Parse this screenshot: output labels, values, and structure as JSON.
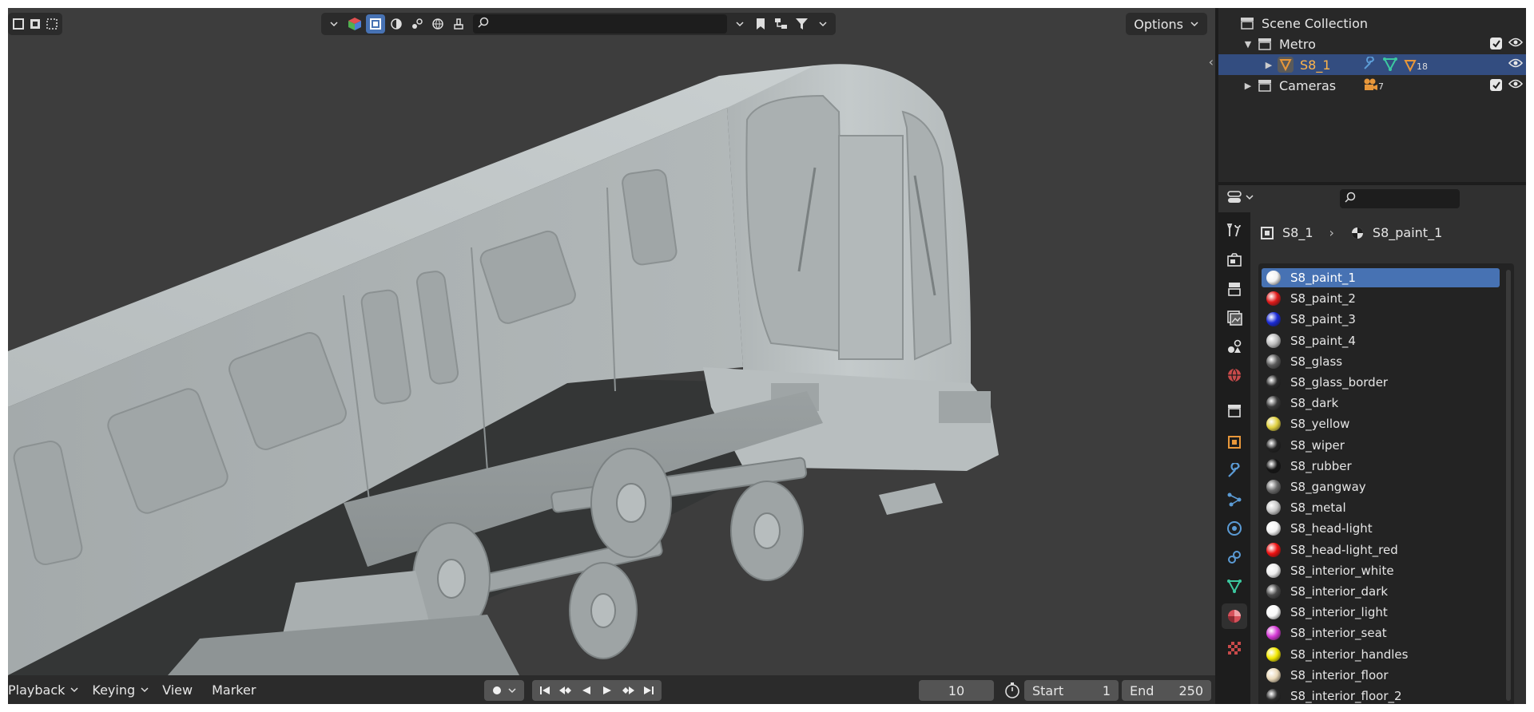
{
  "viewport": {
    "search_placeholder": "",
    "options_label": "Options"
  },
  "outliner": {
    "rows": [
      {
        "label": "Scene Collection"
      },
      {
        "label": "Metro"
      },
      {
        "label": "S8_1",
        "modifier_count": "18"
      },
      {
        "label": "Cameras",
        "camera_count": "7"
      }
    ]
  },
  "properties": {
    "search_placeholder": "",
    "breadcrumb": {
      "object": "S8_1",
      "material": "S8_paint_1"
    },
    "materials": [
      {
        "name": "S8_paint_1",
        "color": "#f2f2f2",
        "selected": true
      },
      {
        "name": "S8_paint_2",
        "color": "#e01a1a"
      },
      {
        "name": "S8_paint_3",
        "color": "#1a2ad6"
      },
      {
        "name": "S8_paint_4",
        "color": "#bdbdbd"
      },
      {
        "name": "S8_glass",
        "color": "#5a5a5a"
      },
      {
        "name": "S8_glass_border",
        "color": "#2a2a2a"
      },
      {
        "name": "S8_dark",
        "color": "#3a3a3a"
      },
      {
        "name": "S8_yellow",
        "color": "#e0d040"
      },
      {
        "name": "S8_wiper",
        "color": "#222222"
      },
      {
        "name": "S8_rubber",
        "color": "#151515"
      },
      {
        "name": "S8_gangway",
        "color": "#6a6a6a"
      },
      {
        "name": "S8_metal",
        "color": "#c8c8c8"
      },
      {
        "name": "S8_head-light",
        "color": "#f4f4f4"
      },
      {
        "name": "S8_head-light_red",
        "color": "#ee1111"
      },
      {
        "name": "S8_interior_white",
        "color": "#ededed"
      },
      {
        "name": "S8_interior_dark",
        "color": "#4a4a4a"
      },
      {
        "name": "S8_interior_light",
        "color": "#fafafa"
      },
      {
        "name": "S8_interior_seat",
        "color": "#d63ad6"
      },
      {
        "name": "S8_interior_handles",
        "color": "#f2e800"
      },
      {
        "name": "S8_interior_floor",
        "color": "#e9d8b8"
      },
      {
        "name": "S8_interior_floor_2",
        "color": "#2a2a2a"
      }
    ]
  },
  "timeline": {
    "menus": [
      "Playback",
      "Keying",
      "View",
      "Marker"
    ],
    "current_frame": "10",
    "start_label": "Start",
    "start_value": "1",
    "end_label": "End",
    "end_value": "250"
  },
  "colors": {
    "selection_blue": "#4772b3",
    "outliner_selected": "#334d80",
    "object_orange": "#e8973a",
    "viewport_bg": "#3d3d3d"
  }
}
